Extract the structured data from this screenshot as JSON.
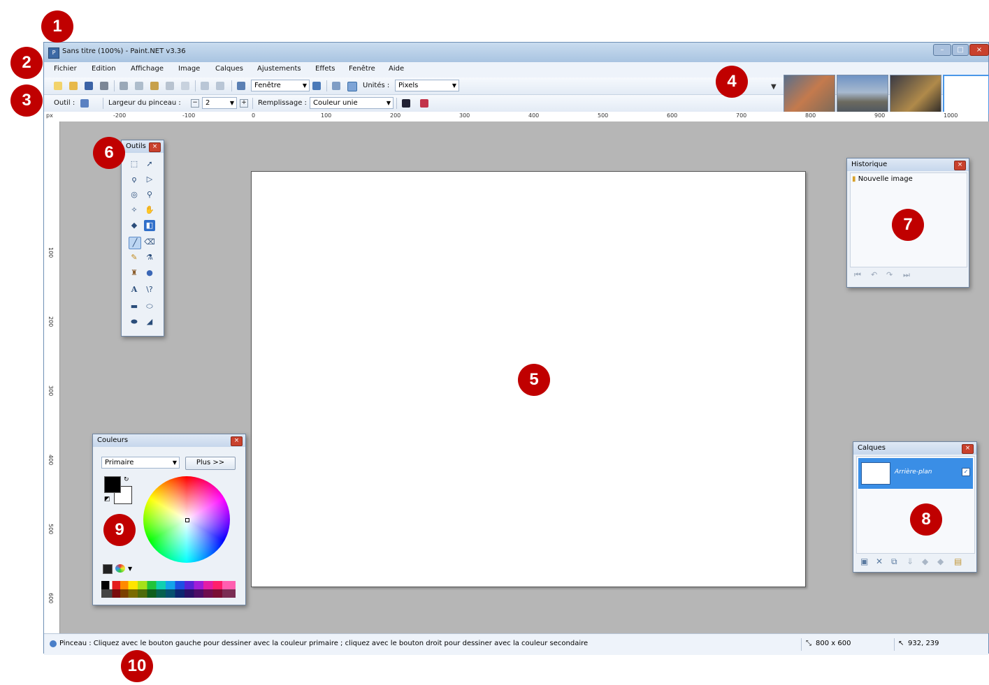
{
  "window": {
    "title": "Sans titre (100%) - Paint.NET v3.36",
    "controls": [
      "–",
      "□",
      "×"
    ]
  },
  "menubar": {
    "items": [
      "Fichier",
      "Edition",
      "Affichage",
      "Image",
      "Calques",
      "Ajustements",
      "Effets",
      "Fenêtre",
      "Aide"
    ]
  },
  "toolbar_main": {
    "zoom_value": "Fenêtre",
    "units_label": "Unités :",
    "units_value": "Pixels"
  },
  "toolbar_tool": {
    "tool_label": "Outil :",
    "brush_width_label": "Largeur du pinceau :",
    "brush_width_value": "2",
    "fill_label": "Remplissage :",
    "fill_value": "Couleur unie"
  },
  "rulers": {
    "unit": "px",
    "horizontal_ticks": [
      "-200",
      "-100",
      "0",
      "100",
      "200",
      "300",
      "400",
      "500",
      "600",
      "700",
      "800",
      "900",
      "1000"
    ],
    "vertical_ticks": [
      "100",
      "200",
      "300",
      "400",
      "500",
      "600"
    ]
  },
  "panels": {
    "tools": {
      "title": "Outils"
    },
    "history": {
      "title": "Historique",
      "items": [
        "Nouvelle image"
      ]
    },
    "colors": {
      "title": "Couleurs",
      "mode": "Primaire",
      "more_button": "Plus >>"
    },
    "layers": {
      "title": "Calques",
      "items": [
        {
          "name": "Arrière-plan",
          "visible": true
        }
      ]
    }
  },
  "statusbar": {
    "message": "Pinceau : Cliquez avec le bouton gauche pour dessiner avec la couleur primaire ; cliquez avec le bouton droit pour dessiner avec la couleur secondaire",
    "image_size": "800 x 600",
    "cursor_position": "932, 239"
  },
  "annotations": [
    "1",
    "2",
    "3",
    "4",
    "5",
    "6",
    "7",
    "8",
    "9",
    "10"
  ],
  "colors": {
    "badge": "#c00000",
    "workspace": "#b6b6b6",
    "layer_selected": "#3a8ee6",
    "primary_color": "#000000",
    "secondary_color": "#ffffff"
  }
}
